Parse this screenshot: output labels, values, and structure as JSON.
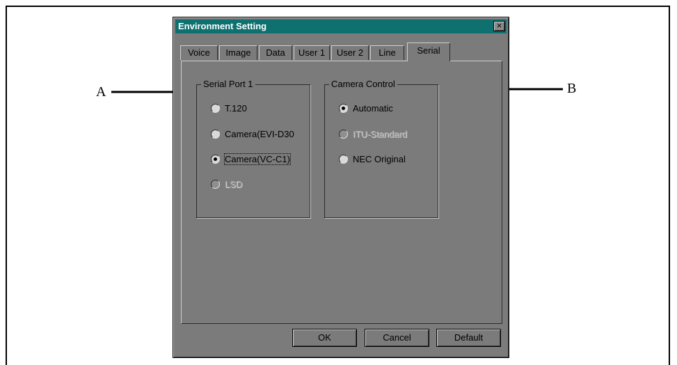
{
  "dialog": {
    "title": "Environment Setting",
    "close_label": "×",
    "tabs": [
      "Voice",
      "Image",
      "Data",
      "User 1",
      "User 2",
      "Line",
      "Serial"
    ],
    "active_tab": "Serial"
  },
  "serial_port": {
    "legend": "Serial Port 1",
    "options": [
      "T.120",
      "Camera(EVI-D30",
      "Camera(VC-C1)",
      "LSD"
    ],
    "selected": "Camera(VC-C1)",
    "disabled": [
      "LSD"
    ]
  },
  "camera_control": {
    "legend": "Camera Control",
    "options": [
      "Automatic",
      "ITU-Standard",
      "NEC Original"
    ],
    "selected": "Automatic",
    "disabled": [
      "ITU-Standard"
    ]
  },
  "buttons": {
    "ok": "OK",
    "cancel": "Cancel",
    "default": "Default"
  },
  "callouts": {
    "a": "A",
    "b": "B"
  }
}
